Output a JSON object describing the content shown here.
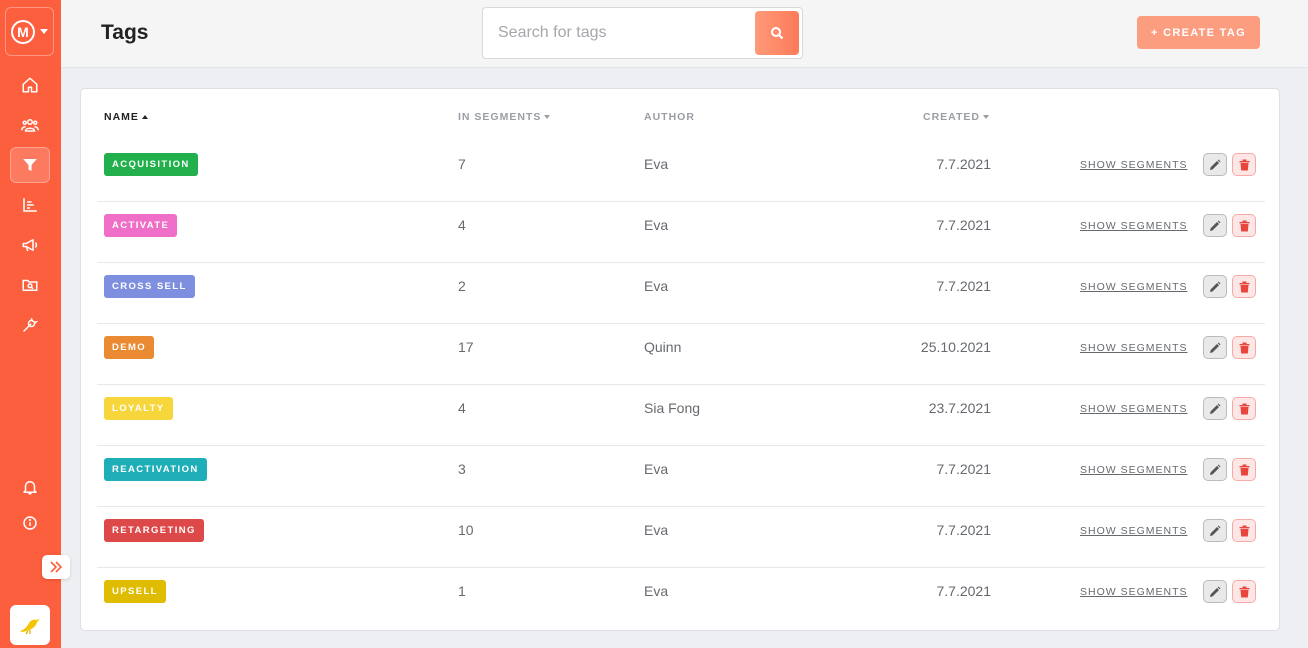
{
  "header": {
    "title": "Tags",
    "search_placeholder": "Search for tags",
    "create_label": "+ CREATE TAG"
  },
  "sidebar": {
    "logo_letter": "M",
    "items": [
      {
        "icon": "home-icon"
      },
      {
        "icon": "users-icon"
      },
      {
        "icon": "filter-icon",
        "active": true
      },
      {
        "icon": "chart-icon"
      },
      {
        "icon": "megaphone-icon"
      },
      {
        "icon": "folder-search-icon"
      },
      {
        "icon": "wrench-icon"
      }
    ],
    "bottom": [
      {
        "icon": "bell-icon"
      },
      {
        "icon": "info-icon"
      }
    ]
  },
  "table": {
    "headers": {
      "name": "NAME",
      "segments": "IN SEGMENTS",
      "author": "AUTHOR",
      "created": "CREATED"
    },
    "show_label": "SHOW SEGMENTS",
    "rows": [
      {
        "name": "ACQUISITION",
        "color": "#21b04b",
        "segments": "7",
        "author": "Eva",
        "created": "7.7.2021"
      },
      {
        "name": "ACTIVATE",
        "color": "#ef6ec8",
        "segments": "4",
        "author": "Eva",
        "created": "7.7.2021"
      },
      {
        "name": "CROSS SELL",
        "color": "#7e8fe0",
        "segments": "2",
        "author": "Eva",
        "created": "7.7.2021"
      },
      {
        "name": "DEMO",
        "color": "#ea8a33",
        "segments": "17",
        "author": "Quinn",
        "created": "25.10.2021"
      },
      {
        "name": "LOYALTY",
        "color": "#f7d63c",
        "segments": "4",
        "author": "Sia Fong",
        "created": "23.7.2021"
      },
      {
        "name": "REACTIVATION",
        "color": "#1eaeb8",
        "segments": "3",
        "author": "Eva",
        "created": "7.7.2021"
      },
      {
        "name": "RETARGETING",
        "color": "#dd4848",
        "segments": "10",
        "author": "Eva",
        "created": "7.7.2021"
      },
      {
        "name": "UPSELL",
        "color": "#e0bc00",
        "segments": "1",
        "author": "Eva",
        "created": "7.7.2021"
      }
    ]
  }
}
